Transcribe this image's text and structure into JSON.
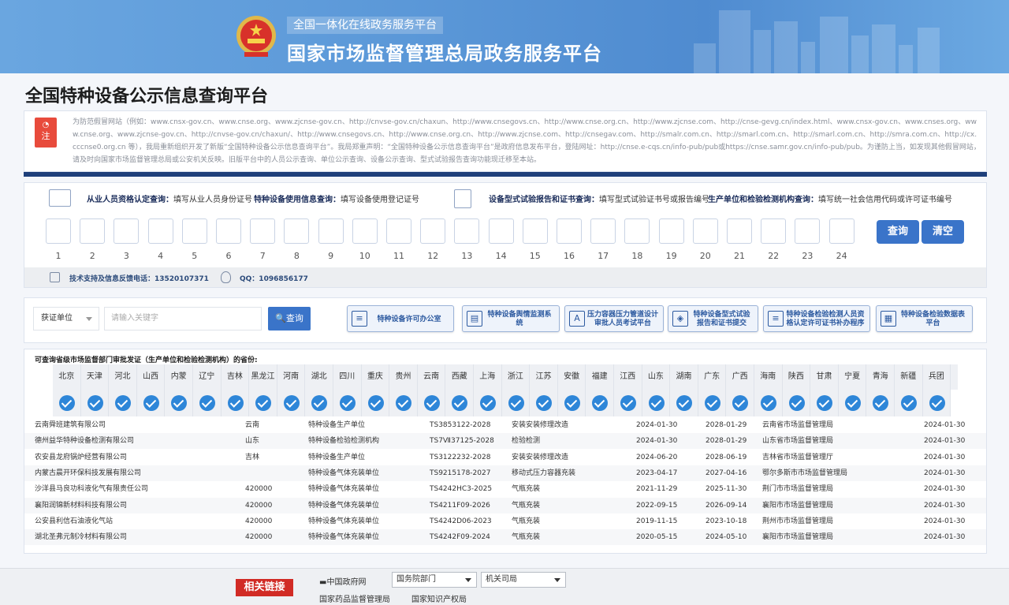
{
  "banner": {
    "subtitle": "全国一体化在线政务服务平台",
    "title": "国家市场监督管理总局政务服务平台"
  },
  "page_title": "全国特种设备公示信息查询平台",
  "notice": {
    "badge": "注",
    "text": "为防范假冒网站（例如：www.cnsx-gov.cn、www.cnse.org、www.zjcnse-gov.cn、http://cnvse-gov.cn/chaxun、http://www.cnsegovs.cn、http://www.cnse.org.cn、http://www.zjcnse.com、http://cnse-gevg.cn/index.html、www.cnsx-gov.cn、www.cnses.org、www.cnse.org、www.zjcnse-gov.cn、http://cnvse-gov.cn/chaxun/、http://www.cnsegovs.cn、http://www.cnse.org.cn、http://www.zjcnse.com、http://cnsegav.com、http://smalr.com.cn、http://smarl.com.cn、http://smarl.com.cn、http://smra.com.cn、http://cx.cccnse0.org.cn 等），我局重新组织开发了新版“全国特种设备公示信息查询平台”。我局郑重声明：“全国特种设备公示信息查询平台”是政府信息发布平台，登陆网址：http://cnse.e-cqs.cn/info-pub/pub或https://cnse.samr.gov.cn/info-pub/pub。为谨防上当，如发现其他假冒网站，请及时向国家市场监督管理总局或公安机关反映。旧版平台中的人员公示查询、单位公示查询、设备公示查询、型式试验报告查询功能现迁移至本站。"
  },
  "query": {
    "hints": [
      {
        "label": "从业人员资格认定查询：",
        "desc": "填写从业人员身份证号"
      },
      {
        "label": "特种设备使用信息查询：",
        "desc": "填写设备使用登记证号"
      },
      {
        "label": "设备型式试验报告和证书查询：",
        "desc": "填写型式试验证书号或报告编号"
      },
      {
        "label": "生产单位和检验检测机构查询：",
        "desc": "填写统一社会信用代码或许可证书编号"
      }
    ],
    "digits": [
      "1",
      "2",
      "3",
      "4",
      "5",
      "6",
      "7",
      "8",
      "9",
      "10",
      "11",
      "12",
      "13",
      "14",
      "15",
      "16",
      "17",
      "18",
      "19",
      "20",
      "21",
      "22",
      "23",
      "24"
    ],
    "search_label": "查询",
    "clear_label": "清空",
    "support_phone": "技术支持及信息反馈电话：13520107371",
    "qq": "QQ：1096856177"
  },
  "filter": {
    "select_value": "获证单位",
    "keyword_placeholder": "请输入关键字",
    "search_label": "查询",
    "quick_links": [
      "特种设备许可办公室",
      "特种设备舆情监测系统",
      "压力容器压力管道设计审批人员考试平台",
      "特种设备型式试验报告和证书提交",
      "特种设备检验检测人员资格认定许可证书补办程序",
      "特种设备检验数据表平台"
    ]
  },
  "list": {
    "title": "可查询省级市场监督部门审批发证（生产单位和检验检测机构）的省份:",
    "provinces": [
      "北京",
      "天津",
      "河北",
      "山西",
      "内蒙",
      "辽宁",
      "吉林",
      "黑龙江",
      "河南",
      "湖北",
      "四川",
      "重庆",
      "贵州",
      "云南",
      "西藏",
      "上海",
      "浙江",
      "江苏",
      "安徽",
      "福建",
      "江西",
      "山东",
      "湖南",
      "广东",
      "广西",
      "海南",
      "陕西",
      "甘肃",
      "宁夏",
      "青海",
      "新疆",
      "兵团"
    ],
    "rows": [
      {
        "name": "云南舜班建筑有限公司",
        "region": "云南",
        "type": "特种设备生产单位",
        "cert": "TS3853122-2028",
        "item": "安装安装修理改造",
        "start": "2024-01-30",
        "end": "2028-01-29",
        "authority": "云南省市场监督管理局",
        "date": "2024-01-30"
      },
      {
        "name": "德州益华特种设备检测有限公司",
        "region": "山东",
        "type": "特种设备检验检测机构",
        "cert": "TS7Ⅶ37125-2028",
        "item": "检验检测",
        "start": "2024-01-30",
        "end": "2028-01-29",
        "authority": "山东省市场监督管理局",
        "date": "2024-01-30"
      },
      {
        "name": "农安县龙府锅炉经营有限公司",
        "region": "吉林",
        "type": "特种设备生产单位",
        "cert": "TS3122232-2028",
        "item": "安装安装修理改造",
        "start": "2024-06-20",
        "end": "2028-06-19",
        "authority": "吉林省市场监督管理厅",
        "date": "2024-01-30"
      },
      {
        "name": "内蒙古晨开环保科技发展有限公司",
        "region": "",
        "type": "特种设备气体充装单位",
        "cert": "TS9215178-2027",
        "item": "移动式压力容器充装",
        "start": "2023-04-17",
        "end": "2027-04-16",
        "authority": "鄂尔多斯市市场监督管理局",
        "date": "2024-01-30"
      },
      {
        "name": "沙洋县马良功科液化气有限责任公司",
        "region": "420000",
        "type": "特种设备气体充装单位",
        "cert": "TS4242HC3-2025",
        "item": "气瓶充装",
        "start": "2021-11-29",
        "end": "2025-11-30",
        "authority": "荆门市市场监督管理局",
        "date": "2024-01-30"
      },
      {
        "name": "襄阳润锦新材料科技有限公司",
        "region": "420000",
        "type": "特种设备气体充装单位",
        "cert": "TS4211F09-2026",
        "item": "气瓶充装",
        "start": "2022-09-15",
        "end": "2026-09-14",
        "authority": "襄阳市市场监督管理局",
        "date": "2024-01-30"
      },
      {
        "name": "公安县利信石油液化气站",
        "region": "420000",
        "type": "特种设备气体充装单位",
        "cert": "TS4242D06-2023",
        "item": "气瓶充装",
        "start": "2019-11-15",
        "end": "2023-10-18",
        "authority": "荆州市市场监督管理局",
        "date": "2024-01-30"
      },
      {
        "name": "湖北圣弗元制冷材料有限公司",
        "region": "420000",
        "type": "特种设备气体充装单位",
        "cert": "TS4242F09-2024",
        "item": "气瓶充装",
        "start": "2020-05-15",
        "end": "2024-05-10",
        "authority": "襄阳市市场监督管理局",
        "date": "2024-01-30"
      }
    ]
  },
  "footer": {
    "related_label": "相关链接",
    "gov_link": "中国政府网",
    "select1": "国务院部门",
    "select2": "机关司局",
    "link1": "国家药品监督管理局",
    "link2": "国家知识产权局"
  },
  "colors": {
    "primary_blue": "#3a74c9",
    "navy_bar": "#1e3f7a",
    "badge_red": "#e84b3c",
    "check_blue": "#2e86d8"
  }
}
